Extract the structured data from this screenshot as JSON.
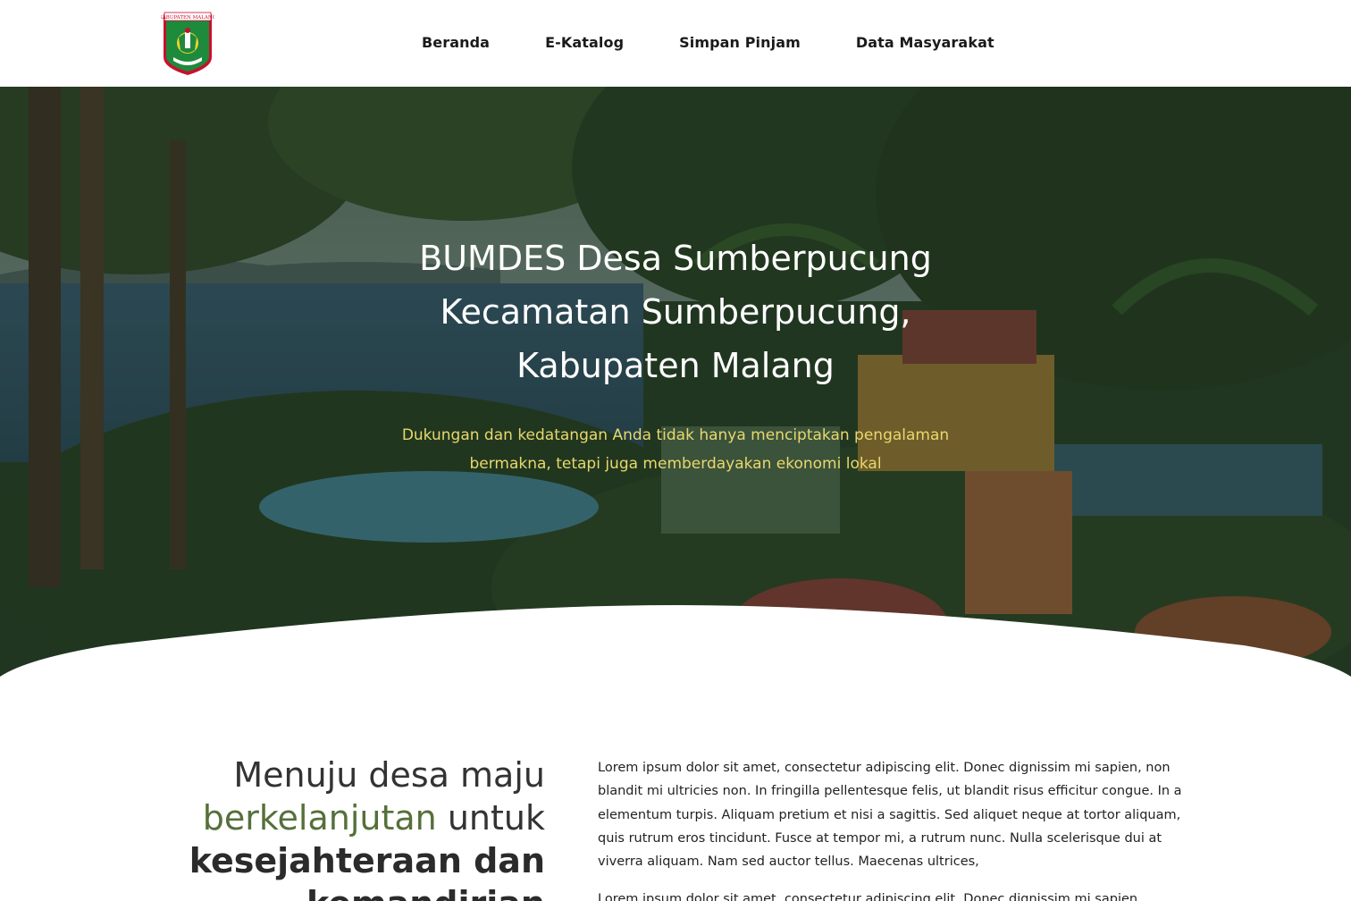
{
  "header": {
    "logo_text": "KABUPATEN MALANG",
    "nav": [
      {
        "label": "Beranda"
      },
      {
        "label": "E-Katalog"
      },
      {
        "label": "Simpan Pinjam"
      },
      {
        "label": "Data Masyarakat"
      }
    ]
  },
  "hero": {
    "title_line1": "BUMDES Desa Sumberpucung",
    "title_line2": "Kecamatan Sumberpucung,",
    "title_line3": "Kabupaten Malang",
    "subtitle_line1": "Dukungan dan kedatangan Anda tidak hanya menciptakan pengalaman",
    "subtitle_line2": "bermakna, tetapi juga memberdayakan ekonomi lokal"
  },
  "about": {
    "heading_part1": "Menuju desa maju",
    "heading_green": "berkelanjutan",
    "heading_part2": " untuk",
    "heading_bold1": "kesejahteraan dan",
    "heading_bold2": "kemandirian",
    "paragraph1": "Lorem ipsum dolor sit amet, consectetur adipiscing elit. Donec dignissim mi sapien, non blandit mi ultricies non. In fringilla pellentesque felis, ut blandit risus efficitur congue. In a elementum turpis. Aliquam pretium et nisi a sagittis. Sed aliquet neque at tortor aliquam, quis rutrum eros tincidunt. Fusce at tempor mi, a rutrum nunc. Nulla scelerisque dui at viverra aliquam. Nam sed auctor tellus. Maecenas ultrices,",
    "paragraph2": "Lorem ipsum dolor sit amet, consectetur adipiscing elit. Donec dignissim mi sapien."
  },
  "colors": {
    "accent_green": "#55703a",
    "subtitle_yellow": "#e8d86b",
    "overlay": "#142016"
  }
}
